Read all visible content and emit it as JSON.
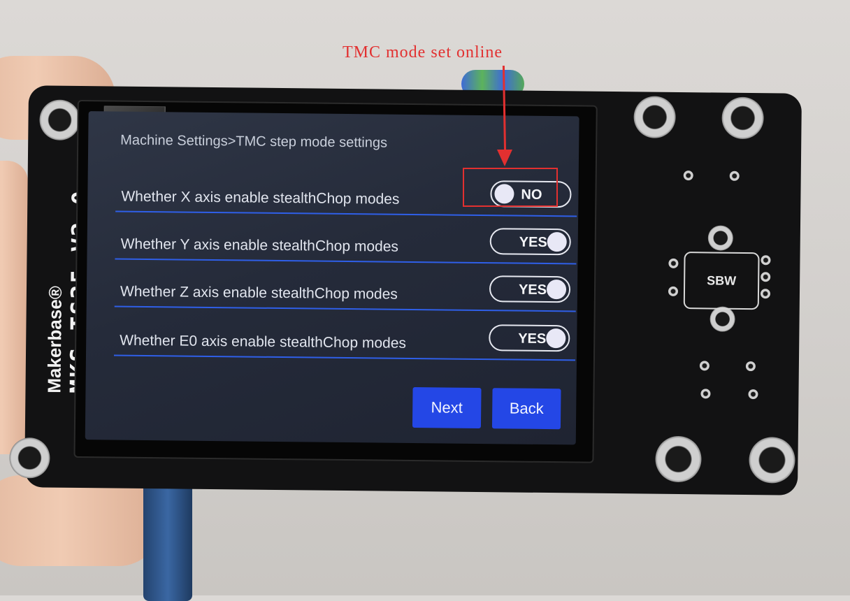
{
  "annotation": {
    "text": "TMC mode set online",
    "color": "#e23030"
  },
  "board": {
    "brand": "Makerbase®",
    "model": "MKS TS35 V2.0",
    "chip_label": "SBW"
  },
  "screen": {
    "breadcrumb": "Machine Settings>TMC step mode settings",
    "rows": [
      {
        "label": "Whether X axis enable stealthChop modes",
        "state": "NO"
      },
      {
        "label": "Whether Y axis enable stealthChop modes",
        "state": "YES"
      },
      {
        "label": "Whether Z axis enable stealthChop modes",
        "state": "YES"
      },
      {
        "label": "Whether E0 axis enable stealthChop modes",
        "state": "YES"
      }
    ],
    "buttons": {
      "next": "Next",
      "back": "Back"
    },
    "accent_color": "#2447e6"
  }
}
